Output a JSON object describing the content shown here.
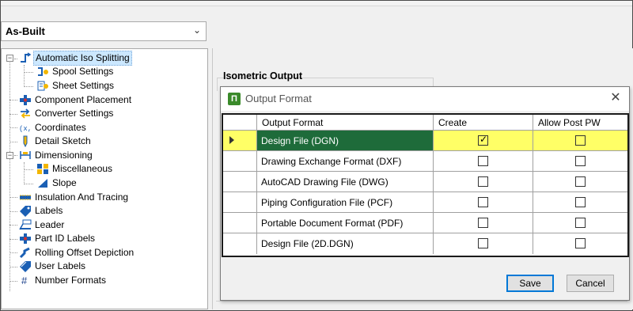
{
  "profile": {
    "value": "As-Built"
  },
  "tree": {
    "items": [
      {
        "label": "Automatic Iso Splitting",
        "icon": "iso-splitting-icon",
        "level": 0,
        "expanded": true,
        "selected": true
      },
      {
        "label": "Spool Settings",
        "icon": "spool-settings-icon",
        "level": 1
      },
      {
        "label": "Sheet Settings",
        "icon": "sheet-settings-icon",
        "level": 1
      },
      {
        "label": "Component Placement",
        "icon": "component-placement-icon",
        "level": 0
      },
      {
        "label": "Converter Settings",
        "icon": "converter-settings-icon",
        "level": 0
      },
      {
        "label": "Coordinates",
        "icon": "coordinates-icon",
        "level": 0
      },
      {
        "label": "Detail Sketch",
        "icon": "detail-sketch-icon",
        "level": 0
      },
      {
        "label": "Dimensioning",
        "icon": "dimensioning-icon",
        "level": 0,
        "expanded": true
      },
      {
        "label": "Miscellaneous",
        "icon": "miscellaneous-icon",
        "level": 1
      },
      {
        "label": "Slope",
        "icon": "slope-icon",
        "level": 1
      },
      {
        "label": "Insulation And Tracing",
        "icon": "insulation-icon",
        "level": 0
      },
      {
        "label": "Labels",
        "icon": "label-tag-icon",
        "level": 0
      },
      {
        "label": "Leader",
        "icon": "leader-icon",
        "level": 0
      },
      {
        "label": "Part ID Labels",
        "icon": "part-id-icon",
        "level": 0
      },
      {
        "label": "Rolling Offset Depiction",
        "icon": "rolling-offset-icon",
        "level": 0
      },
      {
        "label": "User Labels",
        "icon": "user-labels-icon",
        "level": 0
      },
      {
        "label": "Number Formats",
        "icon": "hash-icon",
        "level": 0
      }
    ]
  },
  "background_section": {
    "title": "Isometric Output"
  },
  "dialog": {
    "title": "Output Format",
    "icon": "app-icon",
    "close_icon": "close-icon",
    "columns": [
      "Output Format",
      "Create",
      "Allow Post PW"
    ],
    "rows": [
      {
        "format": "Design File (DGN)",
        "create": true,
        "allow_post_pw": false,
        "selected": true
      },
      {
        "format": "Drawing Exchange Format (DXF)",
        "create": false,
        "allow_post_pw": false
      },
      {
        "format": "AutoCAD Drawing File (DWG)",
        "create": false,
        "allow_post_pw": false
      },
      {
        "format": "Piping Configuration File (PCF)",
        "create": false,
        "allow_post_pw": false
      },
      {
        "format": "Portable Document Format (PDF)",
        "create": false,
        "allow_post_pw": false
      },
      {
        "format": "Design File (2D.DGN)",
        "create": false,
        "allow_post_pw": false
      }
    ],
    "buttons": {
      "save": "Save",
      "cancel": "Cancel"
    },
    "colors": {
      "selected_cell": "#1e6b3a",
      "selected_row": "#ffff66"
    }
  }
}
